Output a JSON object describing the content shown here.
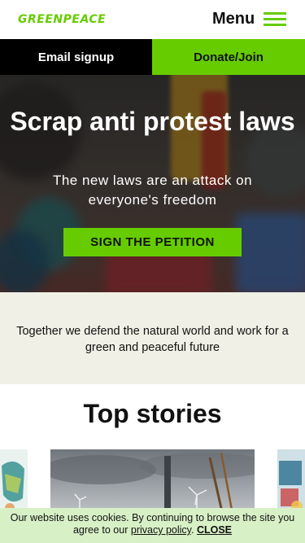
{
  "header": {
    "logo": "GREENPEACE",
    "menu_label": "Menu"
  },
  "cta_bar": {
    "email_signup": "Email signup",
    "donate_join": "Donate/Join"
  },
  "hero": {
    "title": "Scrap anti protest laws",
    "subtitle": "The new laws are an attack on everyone's freedom",
    "button": "SIGN THE PETITION"
  },
  "mission": {
    "text": "Together we defend the natural world and work for a green and peaceful future"
  },
  "top_stories": {
    "title": "Top stories"
  },
  "cookie": {
    "text": "Our website uses cookies. By continuing to browse the site you agree to our",
    "privacy_link": "privacy policy",
    "separator": ".",
    "close": "CLOSE"
  },
  "colors": {
    "brand_green": "#66cc00",
    "mission_bg": "#f1f0e6",
    "cookie_bg": "#d8f0c6"
  },
  "icons": {
    "menu": "hamburger-icon"
  }
}
